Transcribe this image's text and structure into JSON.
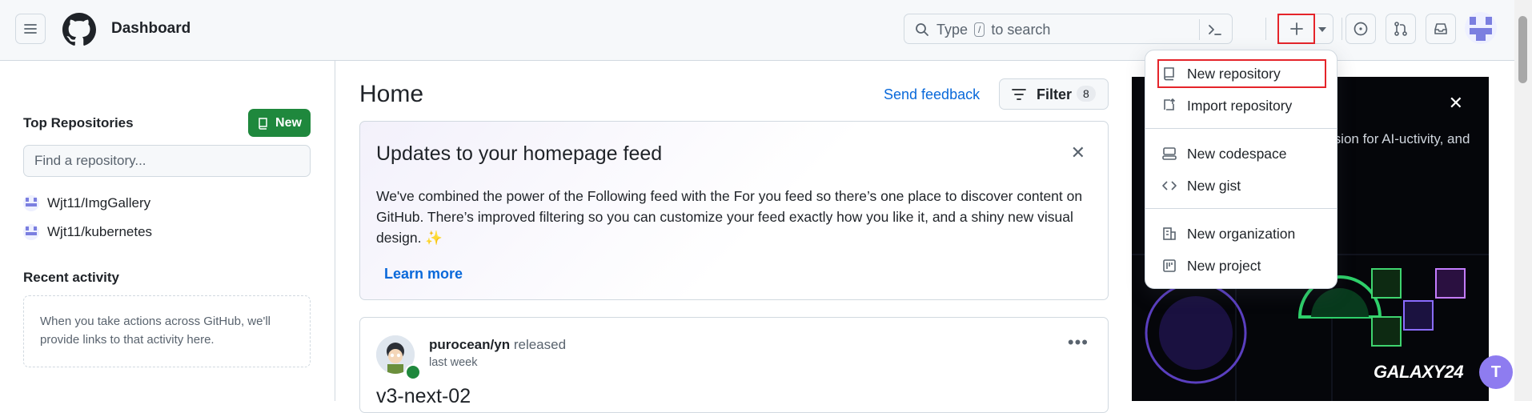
{
  "header": {
    "context_title": "Dashboard",
    "search": {
      "prefix": "Type",
      "key": "/",
      "suffix": "to search"
    },
    "icons": [
      "menu-icon",
      "github-logo-icon",
      "search-icon",
      "command-palette-icon",
      "plus-icon",
      "triangle-down-icon",
      "issue-opened-icon",
      "git-pull-request-icon",
      "inbox-icon"
    ]
  },
  "sidebar": {
    "top_repos_heading": "Top Repositories",
    "new_button": "New",
    "find_placeholder": "Find a repository...",
    "repos": [
      "Wjt11/ImgGallery",
      "Wjt11/kubernetes"
    ],
    "recent_heading": "Recent activity",
    "recent_empty": "When you take actions across GitHub, we'll provide links to that activity here."
  },
  "main": {
    "title": "Home",
    "send_feedback": "Send feedback",
    "filter_label": "Filter",
    "filter_count": "8",
    "updates_card": {
      "title": "Updates to your homepage feed",
      "body": "We've combined the power of the Following feed with the For you feed so there’s one place to discover content on GitHub. There’s improved filtering so you can customize your feed exactly how you like it, and a shiny new visual design. ✨",
      "learn_more": "Learn more"
    },
    "feed_item": {
      "actor": "purocean/yn",
      "action": "released",
      "time": "last week",
      "title": "v3-next-02"
    }
  },
  "promo": {
    "text_visible": "r vision for AI-uctivity, and",
    "galaxy": "GALAXY24"
  },
  "create_menu": {
    "items": [
      {
        "label": "New repository",
        "icon": "repo-icon"
      },
      {
        "label": "Import repository",
        "icon": "repo-push-icon"
      },
      {
        "label": "New codespace",
        "icon": "codespaces-icon"
      },
      {
        "label": "New gist",
        "icon": "code-icon"
      },
      {
        "label": "New organization",
        "icon": "organization-icon"
      },
      {
        "label": "New project",
        "icon": "project-icon"
      }
    ]
  },
  "colors": {
    "accent": "#0969da",
    "primary_button": "#1f883d",
    "highlight": "#e5242a",
    "border": "#d1d9e0"
  }
}
